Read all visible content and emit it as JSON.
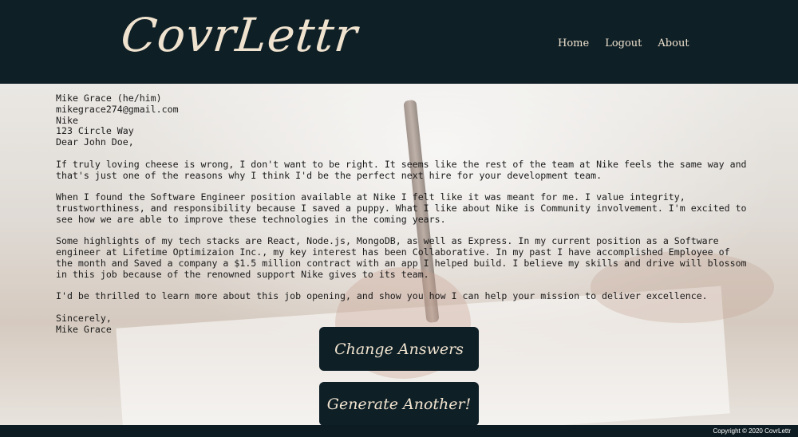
{
  "header": {
    "logo": "CovrLettr",
    "nav": [
      "Home",
      "Logout",
      "About"
    ]
  },
  "letter": {
    "contact": [
      "Mike Grace (he/him)",
      "mikegrace274@gmail.com",
      "Nike",
      "123 Circle Way",
      "Dear John Doe,"
    ],
    "paragraphs": [
      "If truly loving cheese is wrong, I don't want to be right. It seems like the rest of the team at Nike feels the same way and that's just one of the reasons why I think I'd be the perfect next hire for your development team.",
      "When I found the Software Engineer position available at Nike I felt like it was meant for me. I value integrity, trustworthiness, and responsibility because I saved a puppy. What I like about Nike is Community involvement. I'm excited to see how we are able to improve these technologies in the coming years.",
      "Some highlights of my tech stacks are React, Node.js, MongoDB, as well as Express. In my current position as a Software engineer at Lifetime Optimizaion Inc., my key interest has been Collaborative. In my past I have accomplished Employee of the month and Saved a company a $1.5 million contract with an app I helped build. I believe my skills and drive will blossom in this job because of the renowned support Nike gives to its team.",
      "I'd be thrilled to learn more about this job opening, and show you how I can help your mission to deliver excellence."
    ],
    "closing": "Sincerely,",
    "signature": "Mike Grace"
  },
  "buttons": {
    "change": "Change Answers",
    "generate": "Generate Another!"
  },
  "footer": {
    "copyright": "Copyright © 2020 CovrLettr"
  }
}
